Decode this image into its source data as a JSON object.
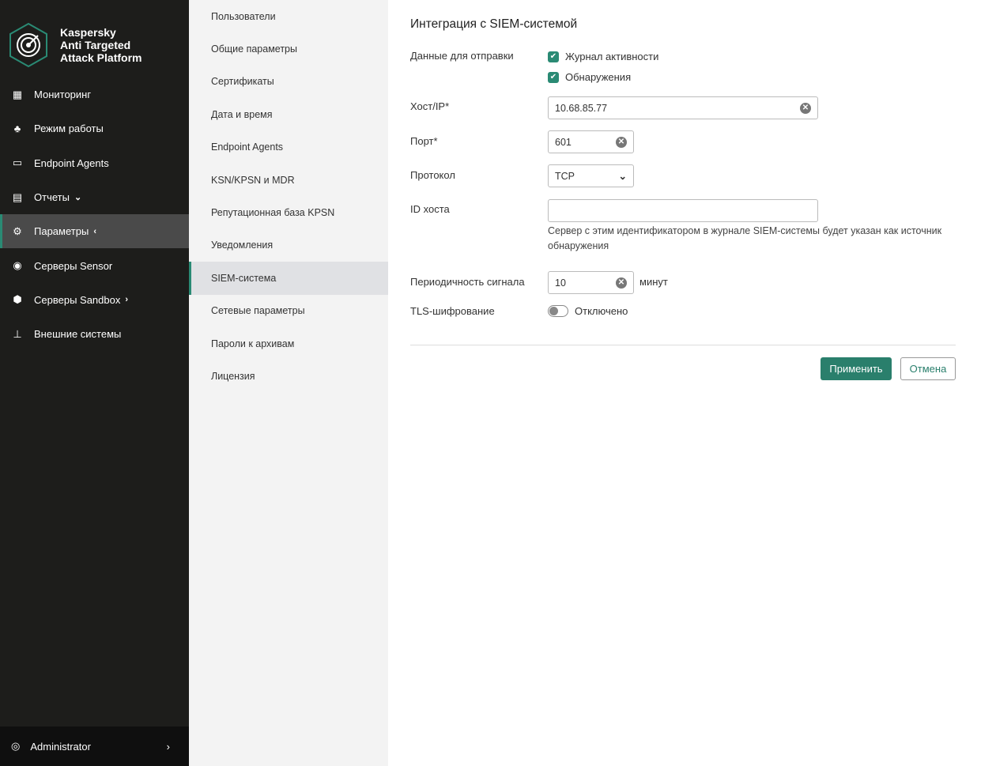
{
  "brand": {
    "line1": "Kaspersky",
    "line2": "Anti Targeted",
    "line3": "Attack Platform"
  },
  "nav": [
    {
      "label": "Мониторинг",
      "icon": "dashboard-icon"
    },
    {
      "label": "Режим работы",
      "icon": "hierarchy-icon"
    },
    {
      "label": "Endpoint Agents",
      "icon": "monitor-icon"
    },
    {
      "label": "Отчеты",
      "icon": "report-icon"
    },
    {
      "label": "Параметры",
      "icon": "gear-icon"
    },
    {
      "label": "Серверы Sensor",
      "icon": "sensor-icon"
    },
    {
      "label": "Серверы Sandbox",
      "icon": "cube-icon"
    },
    {
      "label": "Внешние системы",
      "icon": "network-icon"
    }
  ],
  "user": {
    "name": "Administrator"
  },
  "submenu": [
    "Пользователи",
    "Общие параметры",
    "Сертификаты",
    "Дата и время",
    "Endpoint Agents",
    "KSN/KPSN и MDR",
    "Репутационная база KPSN",
    "Уведомления",
    "SIEM-система",
    "Сетевые параметры",
    "Пароли к архивам",
    "Лицензия"
  ],
  "form": {
    "title": "Интеграция с SIEM-системой",
    "data_label": "Данные для отправки",
    "cb1": "Журнал активности",
    "cb2": "Обнаружения",
    "host_label": "Хост/IP*",
    "host_value": "10.68.85.77",
    "port_label": "Порт*",
    "port_value": "601",
    "proto_label": "Протокол",
    "proto_value": "TCP",
    "id_label": "ID хоста",
    "id_value": "",
    "id_hint": "Сервер с этим идентификатором в журнале SIEM-системы будет указан как источник обнаружения",
    "period_label": "Периодичность сигнала",
    "period_value": "10",
    "period_unit": "минут",
    "tls_label": "TLS-шифрование",
    "tls_state": "Отключено",
    "apply": "Применить",
    "cancel": "Отмена"
  },
  "colors": {
    "accent": "#2a8a74",
    "sidebar": "#1d1d1b"
  }
}
